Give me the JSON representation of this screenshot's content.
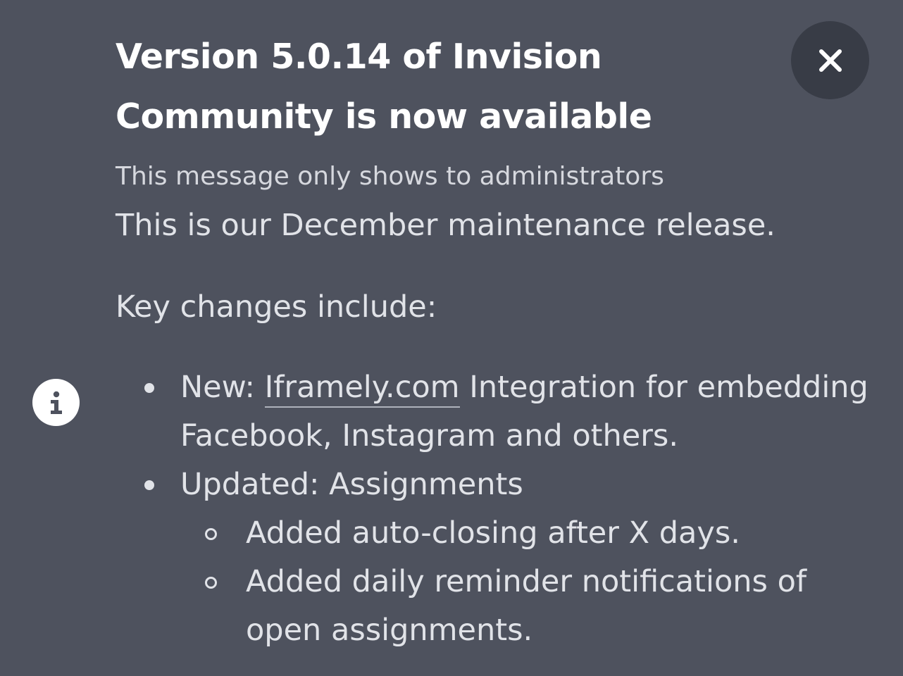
{
  "announcement": {
    "title_prefix": "Version ",
    "title_version": "5.0.14",
    "title_suffix": " of Invision Community is now available",
    "admin_note": "This message only shows to administrators",
    "intro": "This is our December maintenance release.",
    "key_changes_label": "Key changes include:",
    "changes": [
      {
        "prefix": "New: ",
        "link_text": "Iframely.com",
        "suffix": " Integration for embedding Facebook, Instagram and others."
      },
      {
        "text": "Updated: Assignments",
        "subitems": [
          "Added auto-closing after X days.",
          "Added daily reminder notifications of open assignments."
        ]
      }
    ]
  },
  "icons": {
    "close": "close-icon",
    "info": "info-icon"
  },
  "colors": {
    "background": "#4e525e",
    "close_button_bg": "#383c46",
    "text": "#e1e3e8",
    "title": "#ffffff"
  }
}
